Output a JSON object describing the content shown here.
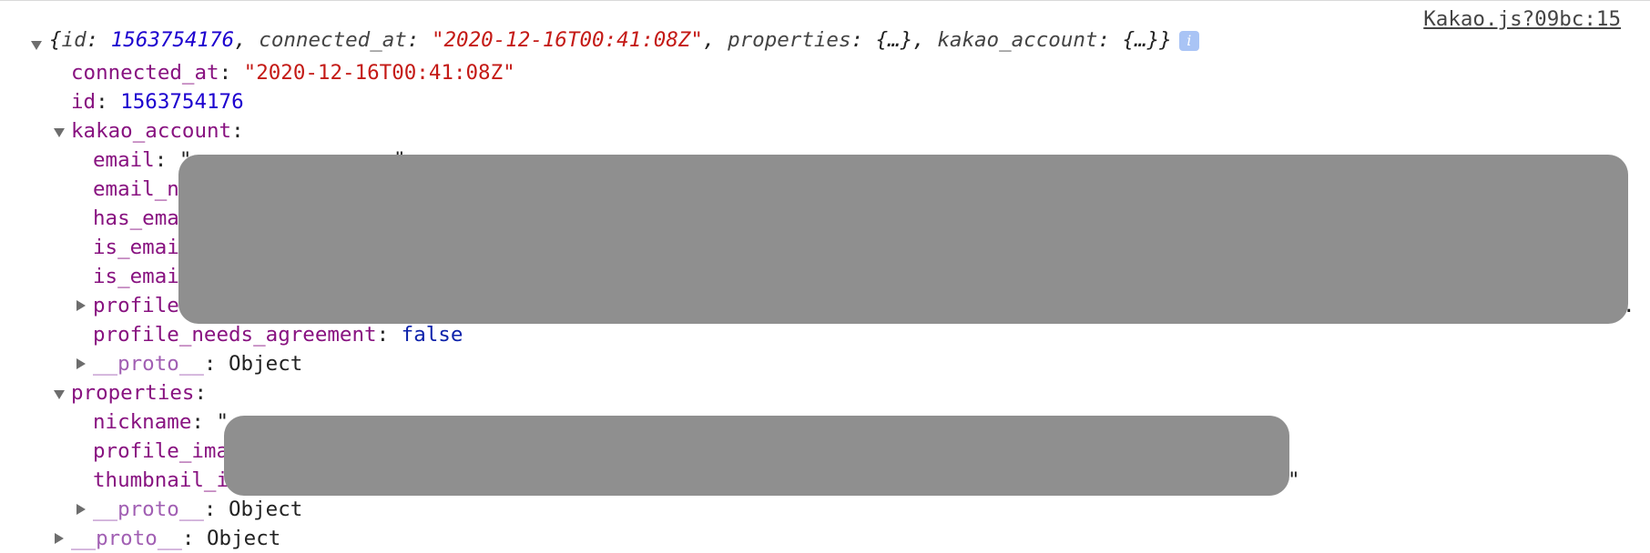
{
  "source_link": "Kakao.js?09bc:15",
  "summary": {
    "open": "{",
    "id_key": "id",
    "id_val": "1563754176",
    "conn_key": "connected_at",
    "conn_val": "\"2020-12-16T00:41:08Z\"",
    "props_key": "properties",
    "props_val": "{…}",
    "kakao_key": "kakao_account",
    "kakao_val": "{…}",
    "close": "}",
    "info_icon": "i"
  },
  "connected_at": {
    "key": "connected_at",
    "value": "\"2020-12-16T00:41:08Z\""
  },
  "id": {
    "key": "id",
    "value": "1563754176"
  },
  "kakao_account": {
    "key": "kakao_account",
    "visible_keys": [
      "email",
      "email_n",
      "has_ema",
      "is_emai",
      "is_emai",
      "profile"
    ],
    "email_quote": "\"",
    "email_tail_quote": "\"",
    "profile_tail": ".",
    "profile_needs_agreement": {
      "key": "profile_needs_agreement",
      "value": "false"
    },
    "proto": {
      "key": "__proto__",
      "value": "Object"
    }
  },
  "properties": {
    "key": "properties",
    "nickname_key": "nickname",
    "nickname_quote": "\"",
    "profile_image_key": "profile_ima",
    "thumbnail_key": "thumbnail_i",
    "thumbnail_tail": "\"",
    "proto": {
      "key": "__proto__",
      "value": "Object"
    }
  },
  "root_proto": {
    "key": "__proto__",
    "value": "Object"
  },
  "icons": {
    "expanded": "triangle-down-icon",
    "collapsed": "triangle-right-icon",
    "info": "info-icon"
  }
}
